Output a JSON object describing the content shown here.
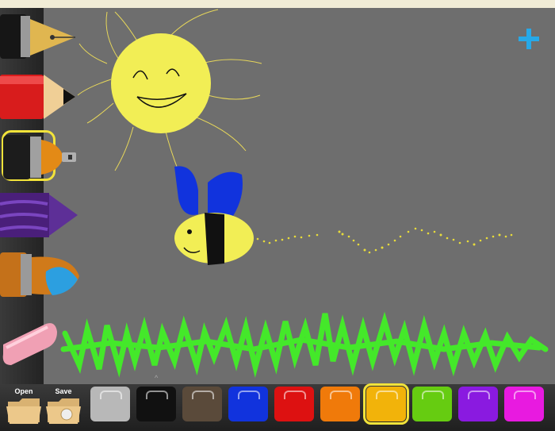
{
  "toolbar": {
    "tools": [
      {
        "name": "pen",
        "icon": "fountain-pen-icon"
      },
      {
        "name": "pencil",
        "icon": "pencil-icon"
      },
      {
        "name": "spray",
        "icon": "spray-can-icon",
        "selected": true
      },
      {
        "name": "crayon",
        "icon": "crayon-icon"
      },
      {
        "name": "paint",
        "icon": "paint-bucket-icon"
      },
      {
        "name": "eraser",
        "icon": "eraser-icon"
      }
    ]
  },
  "actions": {
    "open_label": "Open",
    "save_label": "Save",
    "add_icon": "plus-icon"
  },
  "palette": {
    "colors": [
      "#b8b8b8",
      "#111111",
      "#5a4a3a",
      "#1133dd",
      "#dd1111",
      "#f07a0a",
      "#f2b30a",
      "#66cc11",
      "#8a1ae0",
      "#e81ae0"
    ],
    "selected": "#f2b30a"
  },
  "accent": "#f2e33a"
}
